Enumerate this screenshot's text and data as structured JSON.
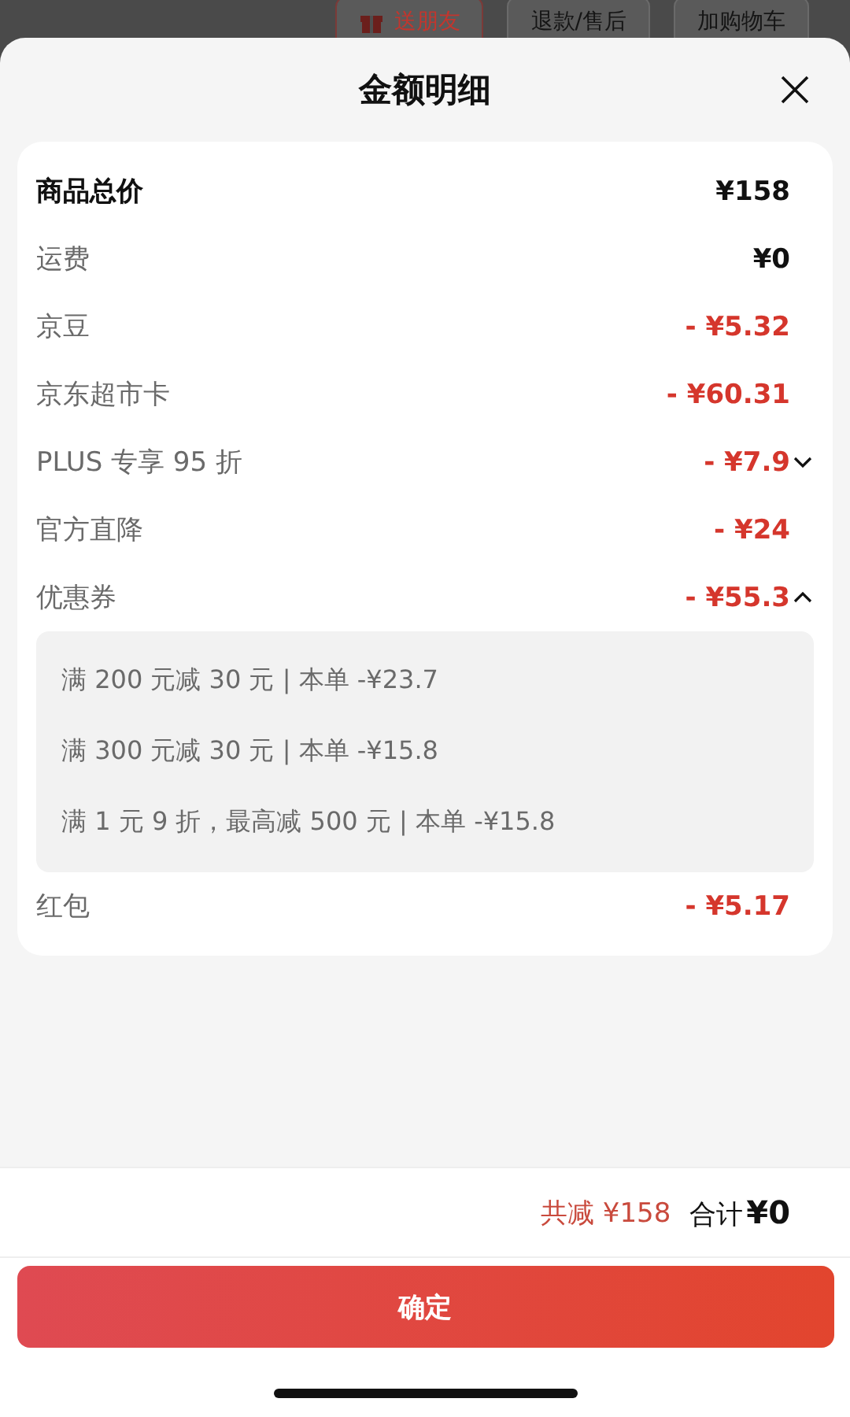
{
  "background_buttons": [
    {
      "label": "送朋友",
      "kind": "gift"
    },
    {
      "label": "退款/售后",
      "kind": "plain"
    },
    {
      "label": "加购物车",
      "kind": "plain"
    }
  ],
  "sheet": {
    "title": "金额明细"
  },
  "rows": [
    {
      "label": "商品总价",
      "value": "¥158",
      "emphasis": true,
      "discount": false
    },
    {
      "label": "运费",
      "value": "¥0",
      "emphasis": false,
      "discount": false
    },
    {
      "label": "京豆",
      "value": "- ¥5.32",
      "emphasis": false,
      "discount": true
    },
    {
      "label": "京东超市卡",
      "value": "- ¥60.31",
      "emphasis": false,
      "discount": true
    },
    {
      "label": "PLUS 专享 95 折",
      "value": "- ¥7.9",
      "emphasis": false,
      "discount": true,
      "expanded": false
    },
    {
      "label": "官方直降",
      "value": "- ¥24",
      "emphasis": false,
      "discount": true
    },
    {
      "label": "优惠券",
      "value": "- ¥55.3",
      "emphasis": false,
      "discount": true,
      "expanded": true,
      "details": [
        "满 200 元减 30 元 | 本单 -¥23.7",
        "满 300 元减 30 元 | 本单 -¥15.8",
        "满 1 元 9 折，最高减 500 元 | 本单 -¥15.8"
      ]
    },
    {
      "label": "红包",
      "value": "- ¥5.17",
      "emphasis": false,
      "discount": true
    }
  ],
  "footer": {
    "saved": "共减 ¥158",
    "total_label": "合计",
    "total_value": "¥0"
  },
  "confirm_button": "确定"
}
